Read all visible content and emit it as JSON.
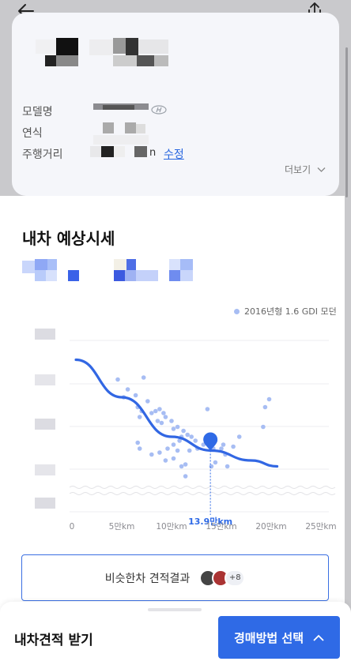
{
  "header": {
    "back_icon": "arrow-left-icon",
    "share_icon": "share-icon"
  },
  "car_info": {
    "labels": {
      "model": "모델명",
      "year": "연식",
      "mileage": "주행거리"
    },
    "mileage_suffix": "n",
    "edit_label": "수정",
    "more_label": "더보기",
    "brand_icon": "hyundai-logo-icon"
  },
  "estimate": {
    "title": "내차 예상시세",
    "legend_label": "2016년형 1.6 GDI 모던",
    "marker_label": "13.9만km",
    "similar_button_label": "비슷한차 견적결과",
    "similar_more_count": "+8"
  },
  "chart_data": {
    "type": "scatter",
    "x_ticks": [
      "0",
      "5만km",
      "10만km",
      "15만km",
      "20만km",
      "25만km"
    ],
    "xlim": [
      0,
      25
    ],
    "xlabel": "",
    "ylabel": "",
    "series": [
      {
        "name": "2016년형 1.6 GDI 모던",
        "type": "scatter",
        "points": [
          [
            4.6,
            79
          ],
          [
            7.2,
            80
          ],
          [
            5.6,
            74
          ],
          [
            5.2,
            70
          ],
          [
            6.4,
            71
          ],
          [
            7.6,
            68
          ],
          [
            6.6,
            65
          ],
          [
            7.0,
            63
          ],
          [
            6.8,
            60
          ],
          [
            8.0,
            62
          ],
          [
            8.4,
            63
          ],
          [
            8.8,
            64
          ],
          [
            9.2,
            62
          ],
          [
            9.4,
            60
          ],
          [
            10.0,
            58
          ],
          [
            8.6,
            58
          ],
          [
            9.0,
            57
          ],
          [
            10.6,
            55
          ],
          [
            10.2,
            54
          ],
          [
            11.2,
            53
          ],
          [
            11.6,
            51
          ],
          [
            12.0,
            50
          ],
          [
            11.0,
            50
          ],
          [
            10.8,
            48
          ],
          [
            10.2,
            46
          ],
          [
            12.4,
            48
          ],
          [
            13.2,
            46
          ],
          [
            14.4,
            48
          ],
          [
            15.2,
            46
          ],
          [
            15.0,
            44
          ],
          [
            14.2,
            44
          ],
          [
            12.6,
            44
          ],
          [
            11.8,
            43
          ],
          [
            10.6,
            43
          ],
          [
            9.6,
            44
          ],
          [
            8.8,
            42
          ],
          [
            9.4,
            38
          ],
          [
            11.4,
            36
          ],
          [
            11.0,
            35
          ],
          [
            10.2,
            39
          ],
          [
            8.0,
            41
          ],
          [
            6.6,
            47
          ],
          [
            6.8,
            44
          ],
          [
            11.4,
            30
          ],
          [
            14.0,
            35
          ],
          [
            14.4,
            37
          ],
          [
            15.4,
            41
          ],
          [
            16.2,
            45
          ],
          [
            16.8,
            50
          ],
          [
            15.6,
            35
          ],
          [
            13.6,
            64
          ],
          [
            19.2,
            55
          ],
          [
            19.4,
            65
          ],
          [
            19.8,
            69
          ]
        ]
      },
      {
        "name": "trend",
        "type": "line",
        "points": [
          [
            0.4,
            89
          ],
          [
            5,
            70
          ],
          [
            10,
            50
          ],
          [
            14,
            43
          ],
          [
            18,
            38
          ],
          [
            20.6,
            35
          ]
        ]
      }
    ],
    "marker": {
      "x": 13.9,
      "y": 43,
      "label": "13.9만km"
    },
    "ylim": [
      20,
      100
    ],
    "grid": true,
    "legend_position": "top-right",
    "colors": {
      "points": "#a7bdf3",
      "trend": "#3267e3",
      "marker": "#2f6ae6"
    }
  },
  "bottom_sheet": {
    "title": "내차견적 받기",
    "auction_button_label": "경매방법 선택",
    "chevron_icon": "chevron-up-icon"
  }
}
